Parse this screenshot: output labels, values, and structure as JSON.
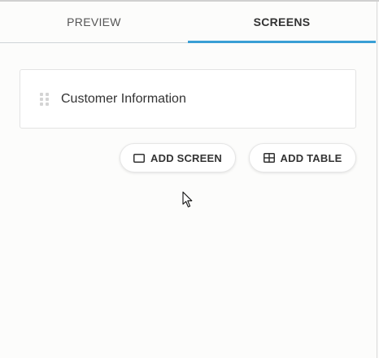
{
  "tabs": [
    {
      "label": "PREVIEW",
      "active": false
    },
    {
      "label": "SCREENS",
      "active": true
    }
  ],
  "screens": [
    {
      "name": "Customer Information"
    }
  ],
  "actions": {
    "add_screen_label": "ADD SCREEN",
    "add_table_label": "ADD TABLE"
  },
  "colors": {
    "active_tab_underline": "#3a9fd5",
    "background": "#fcfcfb"
  },
  "icons": {
    "drag": "drag-handle-icon",
    "screen": "screen-icon",
    "table": "table-icon"
  }
}
